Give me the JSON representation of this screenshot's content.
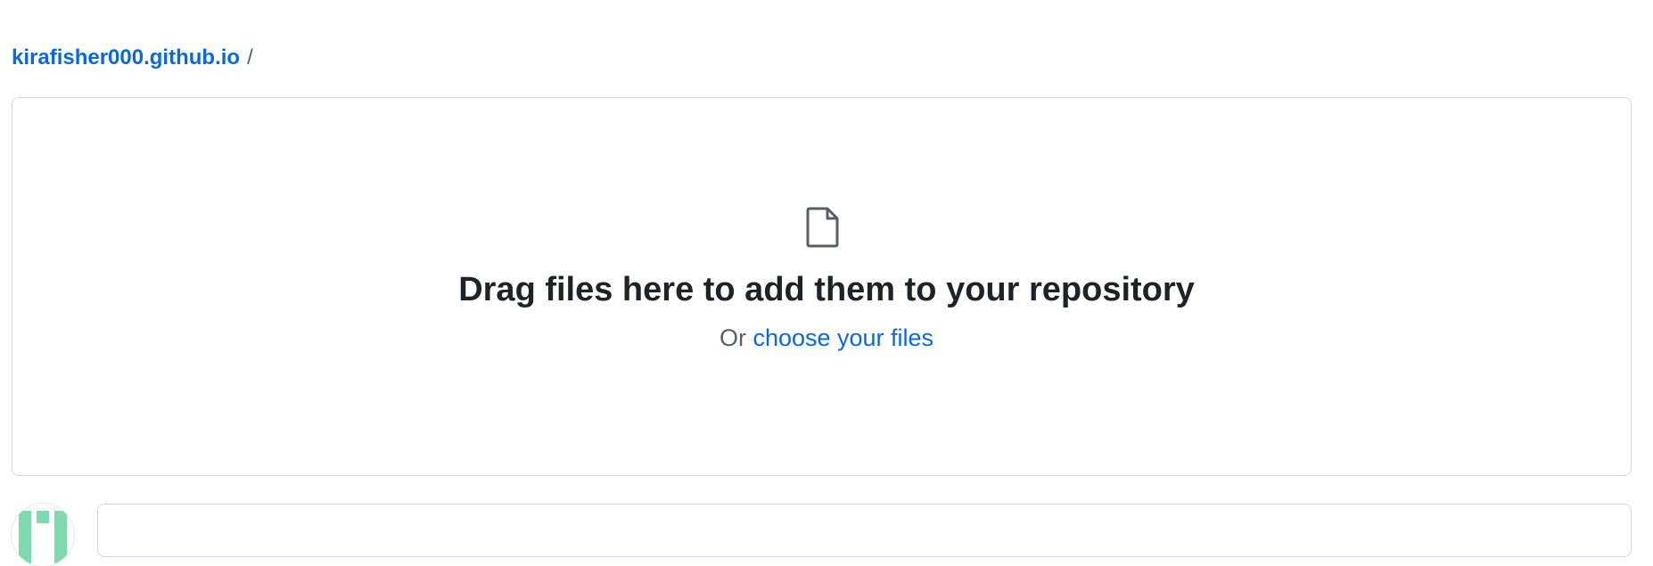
{
  "breadcrumb": {
    "repo_name": "kirafisher000.github.io",
    "separator": "/"
  },
  "dropzone": {
    "icon": "file-icon",
    "title": "Drag files here to add them to your repository",
    "or_text": "Or",
    "choose_link": "choose your files"
  },
  "colors": {
    "link": "#0969da",
    "text": "#1f2328",
    "muted": "#57606a",
    "border": "#d0d7de",
    "avatar_accent": "#7ed9b0"
  }
}
